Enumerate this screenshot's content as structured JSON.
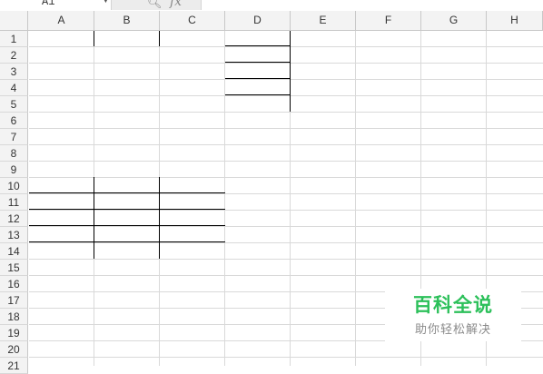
{
  "name_box": {
    "value": "A1"
  },
  "formula_bar": {
    "zoom_icon": "zoom-icon",
    "fx_label": "fx"
  },
  "columns": [
    "A",
    "B",
    "C",
    "D",
    "E",
    "F",
    "G",
    "H"
  ],
  "rows": [
    "1",
    "2",
    "3",
    "4",
    "5",
    "6",
    "7",
    "8",
    "9",
    "10",
    "11",
    "12",
    "13",
    "14",
    "15",
    "16",
    "17",
    "18",
    "19",
    "20",
    "21"
  ],
  "watermark": {
    "title": "百科全说",
    "subtitle": "助你轻松解决"
  }
}
